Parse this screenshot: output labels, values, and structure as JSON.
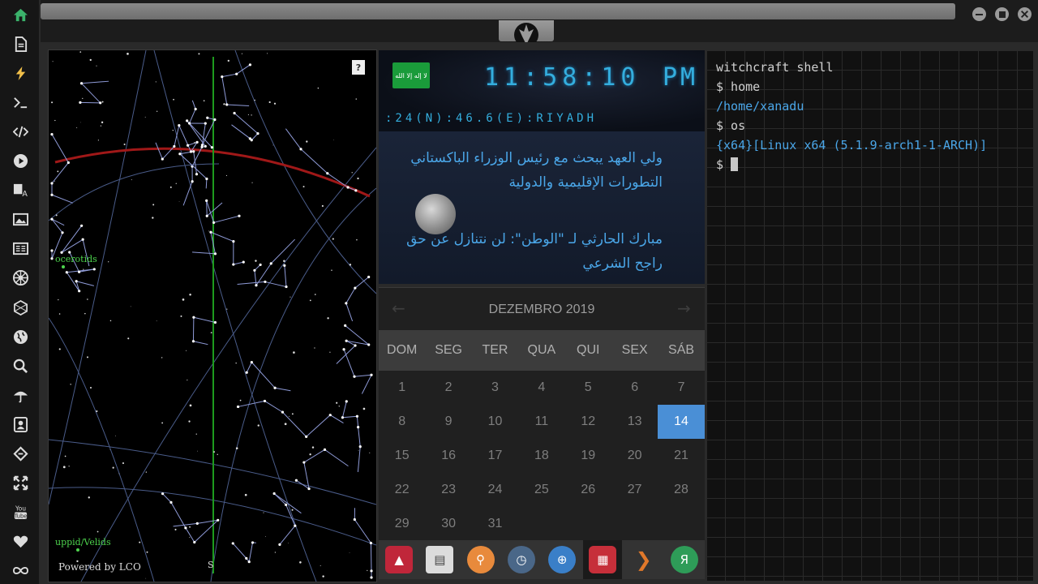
{
  "sidebar": {
    "items": [
      {
        "name": "home-icon",
        "active": true
      },
      {
        "name": "document-icon"
      },
      {
        "name": "lightning-icon"
      },
      {
        "name": "terminal-icon"
      },
      {
        "name": "code-icon"
      },
      {
        "name": "play-icon"
      },
      {
        "name": "translate-icon"
      },
      {
        "name": "image-icon"
      },
      {
        "name": "newspaper-icon"
      },
      {
        "name": "galactic-empire-icon"
      },
      {
        "name": "hexagon-icon"
      },
      {
        "name": "globe-icon"
      },
      {
        "name": "search-icon"
      },
      {
        "name": "umbrella-icon"
      },
      {
        "name": "contact-card-icon"
      },
      {
        "name": "ring-icon"
      },
      {
        "name": "expand-icon"
      },
      {
        "name": "youtube-icon",
        "label": "You Tube"
      },
      {
        "name": "heart-icon"
      },
      {
        "name": "infinity-icon"
      }
    ],
    "accent_color": "#3bb26b"
  },
  "starchart": {
    "help_label": "?",
    "shower_label_1": "ocerotids",
    "shower_label_2": "uppid/Velids",
    "footer": "Powered by LCO",
    "direction": "S"
  },
  "clock": {
    "time": "11:58:10",
    "ampm": "PM",
    "location": ":24(N):46.6(E):RIYADH",
    "flag_text": "لا إله إلا الله"
  },
  "news": {
    "items": [
      "ولي العهد يبحث مع رئيس الوزراء الباكستاني التطورات الإقليمية والدولية",
      "مبارك الحارثي لـ \"الوطن\": لن نتنازل عن حق راجح الشرعي"
    ]
  },
  "calendar": {
    "title": "DEZEMBRO 2019",
    "prev": "←",
    "next": "→",
    "weekdays": [
      "DOM",
      "SEG",
      "TER",
      "QUA",
      "QUI",
      "SEX",
      "SÁB"
    ],
    "weeks": [
      [
        "1",
        "2",
        "3",
        "4",
        "5",
        "6",
        "7"
      ],
      [
        "8",
        "9",
        "10",
        "11",
        "12",
        "13",
        "14"
      ],
      [
        "15",
        "16",
        "17",
        "18",
        "19",
        "20",
        "21"
      ],
      [
        "22",
        "23",
        "24",
        "25",
        "26",
        "27",
        "28"
      ],
      [
        "29",
        "30",
        "31",
        "",
        "",
        "",
        ""
      ]
    ],
    "selected_day": "14",
    "selected_color": "#4a8fd6"
  },
  "dock": {
    "apps": [
      {
        "name": "arch-app-icon",
        "color": "#c0263a",
        "glyph": "▲"
      },
      {
        "name": "news-app-icon",
        "color": "#dcdcdc",
        "glyph": "▤"
      },
      {
        "name": "search-app-icon",
        "color": "#e88a3c",
        "glyph": "⚲"
      },
      {
        "name": "clock-app-icon",
        "color": "#4a6788",
        "glyph": "◷"
      },
      {
        "name": "globe-app-icon",
        "color": "#3a7fc8",
        "glyph": "⊕"
      },
      {
        "name": "calendar-app-icon",
        "color": "#c62f3a",
        "glyph": "▦"
      },
      {
        "name": "arrow-app-icon",
        "color": "#e0782a",
        "glyph": "❯"
      },
      {
        "name": "yandex-app-icon",
        "color": "#2e9c58",
        "glyph": "Я"
      }
    ]
  },
  "terminal": {
    "lines": [
      {
        "text": "witchcraft shell",
        "style": "white"
      },
      {
        "text": "$ home",
        "style": "white"
      },
      {
        "text": "/home/xanadu",
        "style": "blue"
      },
      {
        "text": "$ os",
        "style": "white"
      },
      {
        "text": "{x64}[Linux x64 (5.1.9-arch1-1-ARCH)]",
        "style": "blue"
      },
      {
        "text": "$ ",
        "style": "white"
      }
    ]
  }
}
